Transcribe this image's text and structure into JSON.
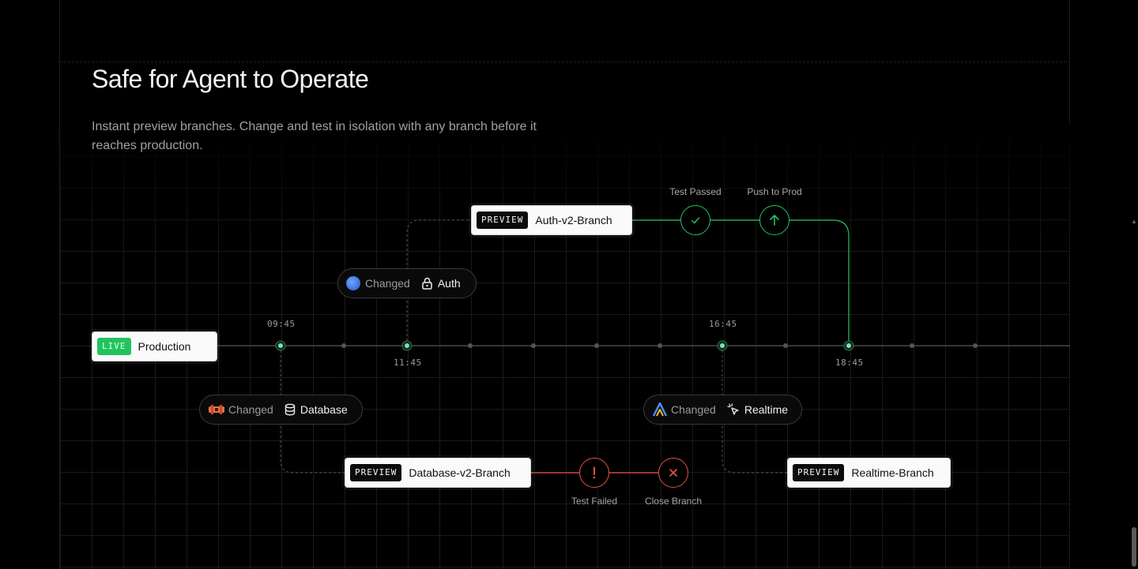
{
  "section": {
    "title": "Safe for Agent to Operate",
    "subtitle": "Instant preview branches. Change and test in isolation with any branch before it reaches production."
  },
  "timeline": {
    "times": [
      "09:45",
      "11:45",
      "16:45",
      "18:45"
    ]
  },
  "production": {
    "tag": "LIVE",
    "label": "Production"
  },
  "branches": [
    {
      "tag": "PREVIEW",
      "label": "Auth-v2-Branch"
    },
    {
      "tag": "PREVIEW",
      "label": "Database-v2-Branch"
    },
    {
      "tag": "PREVIEW",
      "label": "Realtime-Branch"
    }
  ],
  "changes": [
    {
      "changed": "Changed",
      "resource": "Auth"
    },
    {
      "changed": "Changed",
      "resource": "Database"
    },
    {
      "changed": "Changed",
      "resource": "Realtime"
    }
  ],
  "status": {
    "test_passed": "Test Passed",
    "push_to_prod": "Push to Prod",
    "test_failed": "Test Failed",
    "close_branch": "Close Branch"
  },
  "colors": {
    "live": "#22c35e",
    "success": "#22c35e",
    "failure": "#e5533d",
    "node": "#7ee0b0"
  }
}
